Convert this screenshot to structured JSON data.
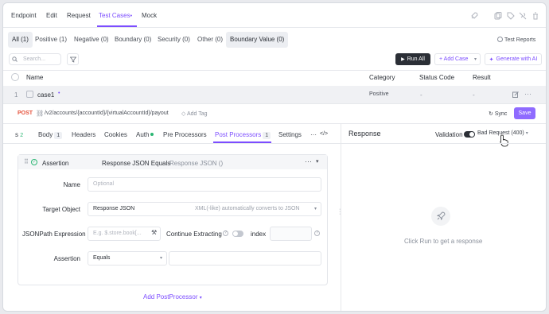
{
  "nav": {
    "items": [
      "Endpoint",
      "Edit",
      "Request",
      "Test Cases",
      "Mock"
    ],
    "active_marker": "•"
  },
  "filters": {
    "chips": [
      "All (1)",
      "Positive (1)",
      "Negative (0)",
      "Boundary (0)",
      "Security (0)",
      "Other (0)",
      "Boundary Value (0)"
    ],
    "test_reports": "Test Reports"
  },
  "toolbar": {
    "search_placeholder": "Search...",
    "run_all": "Run All",
    "add_case": "+ Add Case",
    "generate_ai": "Generate with AI"
  },
  "table": {
    "headers": [
      "Name",
      "Category",
      "Status Code",
      "Result"
    ],
    "row": {
      "index": "1",
      "name": "case1",
      "category": "Positive",
      "status_code": "-",
      "result": "-"
    }
  },
  "request": {
    "method": "POST",
    "path": "/v2/accounts/{accountId}/{virtualAccountId}/payout",
    "add_tag": "Add Tag",
    "sync": "Sync",
    "save": "Save"
  },
  "tabs": {
    "params_suffix": "s",
    "params_count": "2",
    "body": "Body",
    "body_count": "1",
    "headers": "Headers",
    "cookies": "Cookies",
    "auth": "Auth",
    "pre_processors": "Pre Processors",
    "post_processors": "Post Processors",
    "post_count": "1",
    "settings": "Settings",
    "more": "···",
    "code": "</>"
  },
  "assertion": {
    "title": "Assertion",
    "subtitle": "Response JSON Equals",
    "subtitle_muted": "Response JSON ()",
    "name_label": "Name",
    "name_placeholder": "Optional",
    "target_label": "Target Object",
    "target_value": "Response JSON",
    "target_hint": "XML(-like) automatically converts to JSON",
    "jsonpath_label": "JSONPath Expression",
    "jsonpath_placeholder": "E.g. $.store.book[...",
    "continue_label": "Continue Extracting",
    "index_label": "index",
    "assertion_label": "Assertion",
    "assertion_value": "Equals",
    "add_postprocessor": "Add PostProcessor"
  },
  "response": {
    "title": "Response",
    "validation": "Validation",
    "status_select": "Bad Request (400)",
    "empty_text": "Click Run to get a response"
  }
}
